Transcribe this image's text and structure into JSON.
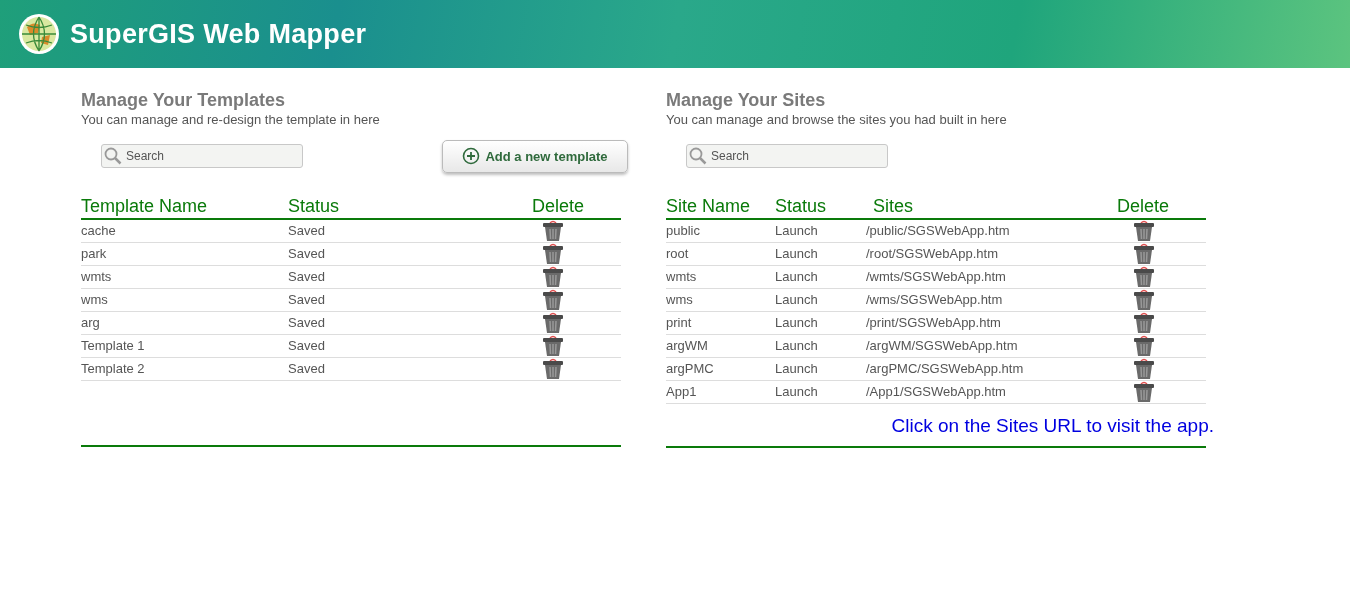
{
  "header": {
    "title": "SuperGIS Web Mapper"
  },
  "templates": {
    "title": "Manage Your Templates",
    "subtitle": "You can manage and re-design the template in here",
    "search": {
      "placeholder": "Search"
    },
    "add_button": "Add a new template",
    "columns": [
      "Template Name",
      "Status",
      "Delete"
    ],
    "rows": [
      {
        "name": "cache",
        "status": "Saved"
      },
      {
        "name": "park",
        "status": "Saved"
      },
      {
        "name": "wmts",
        "status": "Saved"
      },
      {
        "name": "wms",
        "status": "Saved"
      },
      {
        "name": "arg",
        "status": "Saved"
      },
      {
        "name": "Template 1",
        "status": "Saved"
      },
      {
        "name": "Template 2",
        "status": "Saved"
      }
    ]
  },
  "sites": {
    "title": "Manage Your Sites",
    "subtitle": "You can manage and browse the sites you had built in here",
    "search": {
      "placeholder": "Search"
    },
    "columns": [
      "Site Name",
      "Status",
      "Sites",
      "Delete"
    ],
    "rows": [
      {
        "name": "public",
        "status": "Launch",
        "url": "/public/SGSWebApp.htm"
      },
      {
        "name": "root",
        "status": "Launch",
        "url": "/root/SGSWebApp.htm"
      },
      {
        "name": "wmts",
        "status": "Launch",
        "url": "/wmts/SGSWebApp.htm"
      },
      {
        "name": "wms",
        "status": "Launch",
        "url": "/wms/SGSWebApp.htm"
      },
      {
        "name": "print",
        "status": "Launch",
        "url": "/print/SGSWebApp.htm"
      },
      {
        "name": "argWM",
        "status": "Launch",
        "url": "/argWM/SGSWebApp.htm"
      },
      {
        "name": "argPMC",
        "status": "Launch",
        "url": "/argPMC/SGSWebApp.htm"
      },
      {
        "name": "App1",
        "status": "Launch",
        "url": "/App1/SGSWebApp.htm"
      }
    ],
    "note": "Click on the Sites URL to visit the app."
  }
}
